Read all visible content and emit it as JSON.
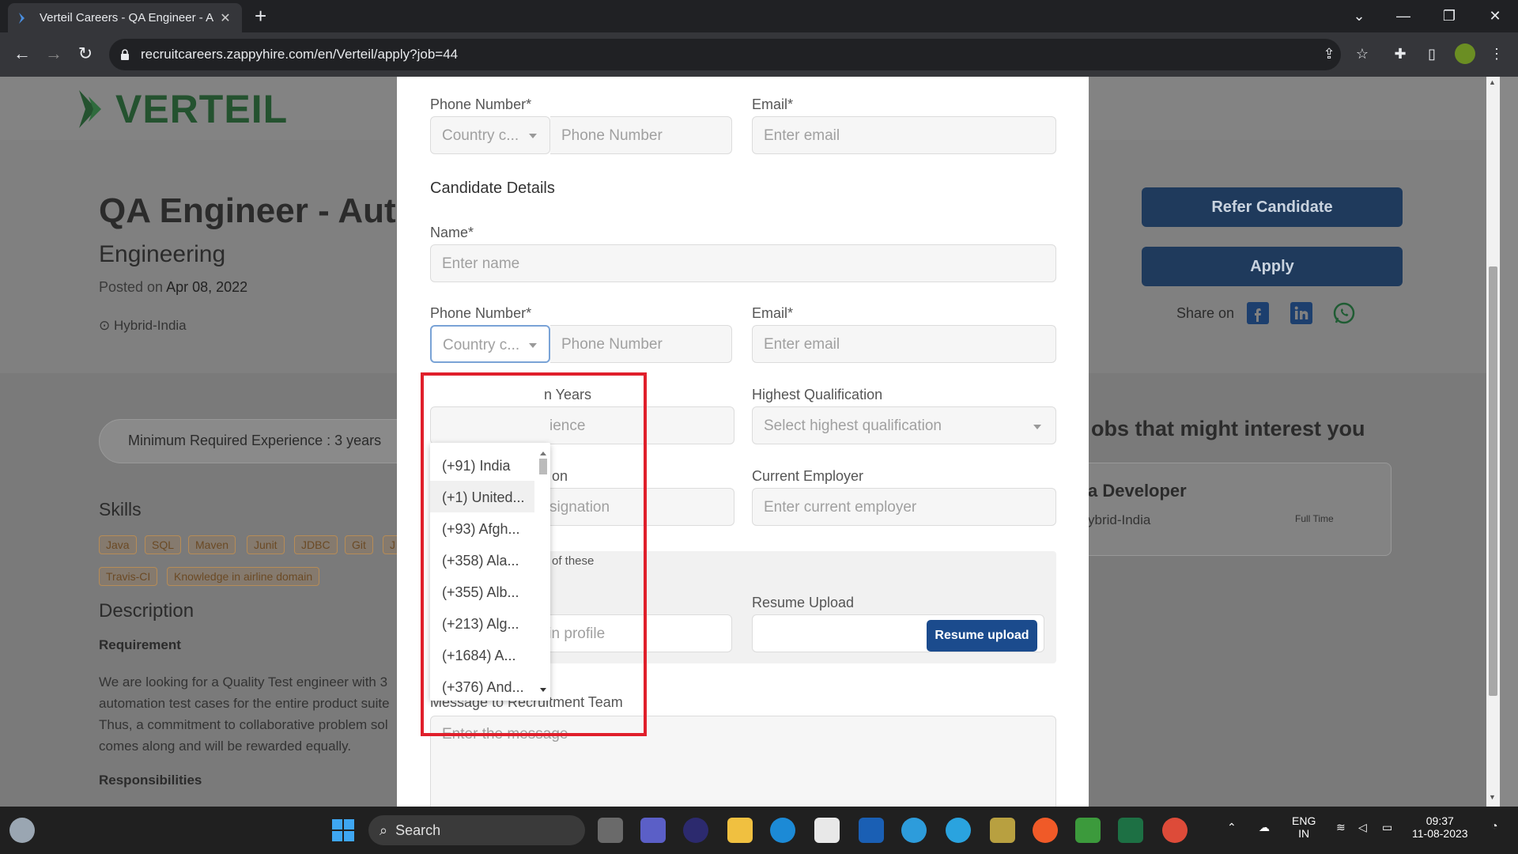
{
  "browser": {
    "tab_title": "Verteil Careers - QA Engineer - A",
    "url": "recruitcareers.zappyhire.com/en/Verteil/apply?job=44"
  },
  "page": {
    "logo_text": "VERTEIL",
    "job_title": "QA Engineer - Aut",
    "department": "Engineering",
    "posted_label": "Posted on",
    "posted_date": "Apr 08, 2022",
    "location": "Hybrid-India",
    "min_experience": "Minimum Required Experience : 3 years",
    "skills_heading": "Skills",
    "skills": [
      "Java",
      "SQL",
      "Maven",
      "Junit",
      "JDBC",
      "Git",
      "J",
      "Travis-CI",
      "Knowledge in airline domain"
    ],
    "description_heading": "Description",
    "requirement_heading": "Requirement",
    "description_lines": [
      "We are looking for a Quality Test engineer with 3",
      "automation test cases for the entire product suite",
      "Thus, a commitment to collaborative problem sol",
      "comes along and will be rewarded equally."
    ],
    "responsibilities_heading": "Responsibilities",
    "refer_button": "Refer Candidate",
    "apply_button": "Apply",
    "share_label": "Share on",
    "interest_heading": "obs that might interest you",
    "job_card": {
      "title": "a Developer",
      "location": "ybrid-India",
      "type": "Full Time"
    }
  },
  "modal": {
    "top_phone_label": "Phone Number*",
    "top_country_placeholder": "Country c...",
    "top_phone_placeholder": "Phone Number",
    "top_email_label": "Email*",
    "top_email_placeholder": "Enter email",
    "candidate_heading": "Candidate Details",
    "name_label": "Name*",
    "name_placeholder": "Enter name",
    "phone_label": "Phone Number*",
    "country_placeholder": "Country c...",
    "phone_placeholder": "Phone Number",
    "email_label": "Email*",
    "email_placeholder": "Enter email",
    "experience_label_partial": "n Years",
    "experience_placeholder_partial": "ience",
    "qualification_label": "Highest Qualification",
    "qualification_placeholder": "Select highest qualification",
    "designation_label_partial": "on",
    "designation_placeholder_partial": "signation",
    "employer_label": "Current Employer",
    "employer_placeholder": "Enter current employer",
    "note_partial": "of these",
    "linkedin_placeholder": "Enter linkedin profile",
    "resume_label": "Resume Upload",
    "resume_button": "Resume upload",
    "message_label": "Message to Recruitment Team",
    "message_placeholder": "Enter the message"
  },
  "country_dropdown": {
    "options": [
      "(+91) India",
      "(+1) United...",
      "(+93) Afgh...",
      "(+358) Ala...",
      "(+355) Alb...",
      "(+213) Alg...",
      "(+1684) A...",
      "(+376) And..."
    ],
    "highlighted_index": 1
  },
  "taskbar": {
    "search_label": "Search",
    "lang_line1": "ENG",
    "lang_line2": "IN",
    "time": "09:37",
    "date": "11-08-2023"
  },
  "colors": {
    "highlight_box": "#e01f2b",
    "primary_button": "#1b4b8d"
  }
}
